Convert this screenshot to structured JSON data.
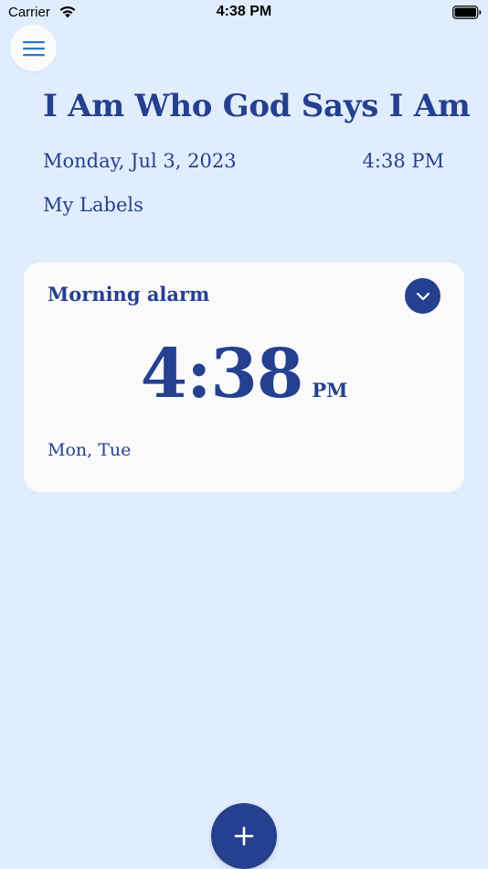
{
  "status_bar": {
    "carrier": "Carrier",
    "time": "4:38 PM",
    "wifi_icon": "wifi-icon",
    "battery_icon": "battery-icon"
  },
  "header": {
    "menu_icon": "hamburger-menu-icon",
    "title": "I Am Who God Says I Am",
    "date": "Monday, Jul 3, 2023",
    "time": "4:38 PM",
    "labels_link": "My Labels"
  },
  "alarms": [
    {
      "name": "Morning alarm",
      "time": "4:38",
      "period": "PM",
      "days": "Mon, Tue",
      "expand_icon": "chevron-down-icon"
    }
  ],
  "fab": {
    "icon": "plus-icon"
  },
  "colors": {
    "background": "#e1edfd",
    "accent": "#25408f",
    "card": "#fafafa",
    "menu_icon": "#2a78c8"
  }
}
